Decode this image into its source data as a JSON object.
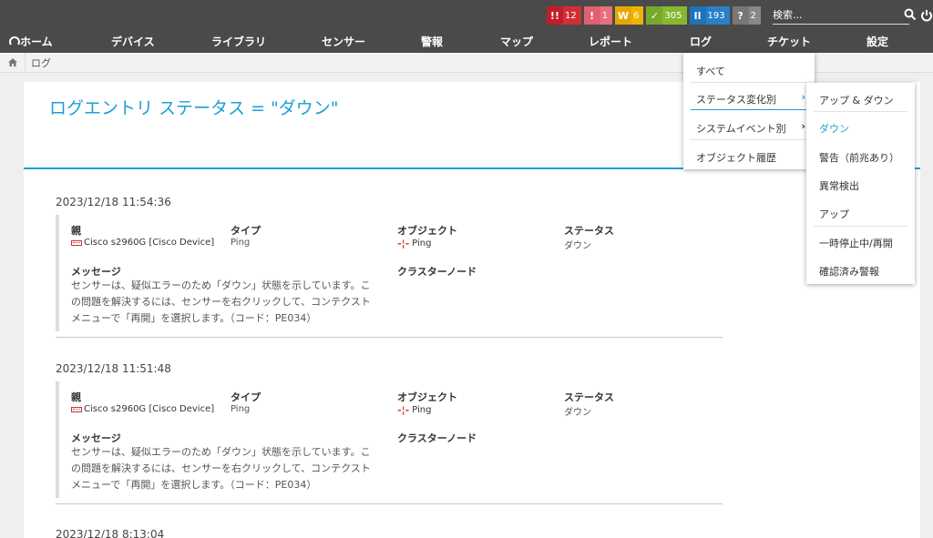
{
  "status_badges": [
    {
      "icon": "!!",
      "count": "12",
      "icon_bg": "#c21e2a",
      "count_bg": "#d22e38"
    },
    {
      "icon": "!",
      "count": "1",
      "icon_bg": "#e06070",
      "count_bg": "#e8707e"
    },
    {
      "icon": "W",
      "count": "6",
      "icon_bg": "#e6a800",
      "count_bg": "#f0b400"
    },
    {
      "icon": "✓",
      "count": "305",
      "icon_bg": "#7aa82a",
      "count_bg": "#86b830"
    },
    {
      "icon": "II",
      "count": "193",
      "icon_bg": "#1e73b8",
      "count_bg": "#2a80c6"
    },
    {
      "icon": "?",
      "count": "2",
      "icon_bg": "#777777",
      "count_bg": "#888888"
    }
  ],
  "search": {
    "placeholder": "検索..."
  },
  "nav": {
    "home": "ホーム",
    "devices": "デバイス",
    "library": "ライブラリ",
    "sensors": "センサー",
    "alarms": "警報",
    "maps": "マップ",
    "reports": "レポート",
    "logs": "ログ",
    "tickets": "チケット",
    "setup": "設定"
  },
  "breadcrumb": {
    "current": "ログ"
  },
  "page": {
    "title": "ログエントリ ステータス = \"ダウン\""
  },
  "labels": {
    "parent": "親",
    "type": "タイプ",
    "object": "オブジェクト",
    "status": "ステータス",
    "message": "メッセージ",
    "cluster_node": "クラスターノード"
  },
  "entries": [
    {
      "timestamp": "2023/12/18 11:54:36",
      "parent": "Cisco s2960G [Cisco Device]",
      "type": "Ping",
      "object": "Ping",
      "status": "ダウン",
      "message_lines": [
        "センサーは、疑似エラーのため「ダウン」状態を示しています。こ",
        "の問題を解決するには、センサーを右クリックして、コンテクスト",
        "メニューで「再開」を選択します。（コード：PE034）"
      ]
    },
    {
      "timestamp": "2023/12/18 11:51:48",
      "parent": "Cisco s2960G [Cisco Device]",
      "type": "Ping",
      "object": "Ping",
      "status": "ダウン",
      "message_lines": [
        "センサーは、疑似エラーのため「ダウン」状態を示しています。こ",
        "の問題を解決するには、センサーを右クリックして、コンテクスト",
        "メニューで「再開」を選択します。（コード：PE034）"
      ]
    },
    {
      "timestamp": "2023/12/18 8:13:04"
    }
  ],
  "menu_logs": {
    "all": "すべて",
    "by_status": "ステータス変化別",
    "by_system_event": "システムイベント別",
    "object_history": "オブジェクト履歴"
  },
  "menu_status": {
    "up_down": "アップ & ダウン",
    "down": "ダウン",
    "warning": "警告（前兆あり）",
    "unusual": "異常検出",
    "up": "アップ",
    "paused": "一時停止中/再開",
    "acknowledged": "確認済み警報"
  },
  "colors": {
    "accent": "#1a9fd4",
    "topbar": "#4a4a4a"
  }
}
